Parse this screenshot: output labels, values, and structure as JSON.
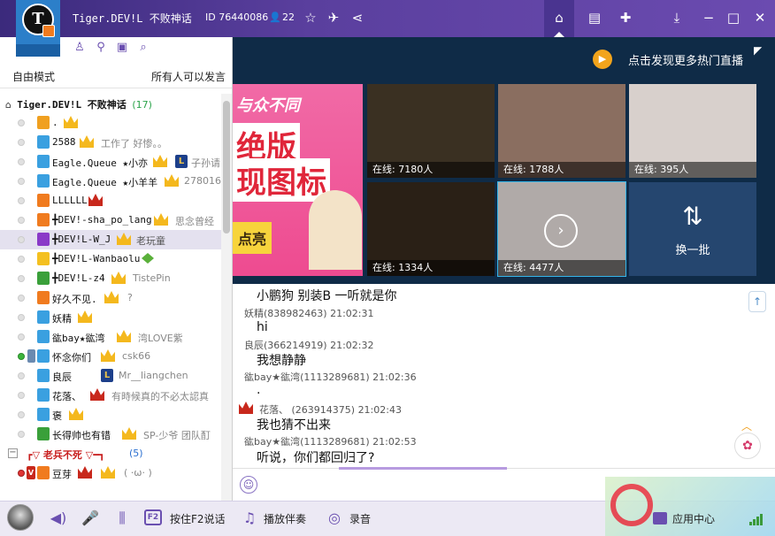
{
  "titlebar": {
    "logo_letter": "T",
    "channel_name": "Tiger.DEV!L 不败神话",
    "id_label": "ID 76440086",
    "online_count": "22"
  },
  "left": {
    "mode": "自由模式",
    "speak_rule": "所有人可以发言",
    "channel": {
      "name": "Tiger.DEV!L 不败神话",
      "count": "(17)"
    },
    "users": [
      {
        "name": ".",
        "sig": "",
        "rank_color": "#f0a020"
      },
      {
        "name": "2588",
        "sig": "工作了 好惨。。",
        "rank_color": "#3aa0e0"
      },
      {
        "name": "Eagle.Queue ★小亦",
        "sig": "子孙请",
        "rank_color": "#3aa0e0"
      },
      {
        "name": "Eagle.Queue ★小羊羊",
        "sig": "278016",
        "rank_color": "#3aa0e0"
      },
      {
        "name": "LLLLLL",
        "sig": "",
        "rank_color": "#f07b1f"
      },
      {
        "name": "╋DEV!-sha_po_lang",
        "sig": "思念曾经",
        "rank_color": "#f07b1f"
      },
      {
        "name": "╋DEV!L-W_J",
        "sig": "老玩童",
        "rank_color": "#8a3ac8"
      },
      {
        "name": "╋DEV!L-Wanbaolu",
        "sig": "",
        "rank_color": "#f4c020"
      },
      {
        "name": "╋DEV!L-z4",
        "sig": "TistePin",
        "rank_color": "#3aa03a"
      },
      {
        "name": "好久不见.",
        "sig": "?",
        "rank_color": "#f07b1f"
      },
      {
        "name": "妖精",
        "sig": "",
        "rank_color": "#3aa0e0"
      },
      {
        "name": "谹bay★谹湾",
        "sig": "湾LOVE紫",
        "rank_color": "#3aa0e0"
      },
      {
        "name": "怀念你们",
        "sig": "csk66",
        "rank_color": "#3aa0e0"
      },
      {
        "name": "良辰",
        "sig": "Mr__liangchen",
        "rank_color": "#3aa0e0"
      },
      {
        "name": "花落、",
        "sig": "有時候真的不必太認真",
        "rank_color": "#3aa0e0"
      },
      {
        "name": "褒",
        "sig": "",
        "rank_color": "#3aa0e0"
      },
      {
        "name": "长得帅也有错",
        "sig": "SP-少爷  团队酊",
        "rank_color": "#3aa03a"
      }
    ],
    "group": {
      "name": "┏▽ 老兵不死 ▽━┓",
      "count": "(5)"
    },
    "group_user": {
      "name": "豆芽",
      "sig": "( ·ω· )"
    }
  },
  "stage": {
    "discover": "点击发现更多热门直播",
    "banner": {
      "line1": "与众不同",
      "line2": "绝版",
      "line3": "现图标",
      "line4": "点亮"
    },
    "tiles": [
      {
        "caption": "在线: 7180人",
        "bg": "#3a3022"
      },
      {
        "caption": "在线: 1788人",
        "bg": "#8a6e60"
      },
      {
        "caption": "在线: 395人",
        "bg": "#d8d0cc"
      },
      {
        "caption": "在线: 1334人",
        "bg": "#2a2016"
      },
      {
        "caption": "在线: 4477人",
        "bg": "#b0aaa8"
      }
    ],
    "refresh": "换一批"
  },
  "chat": {
    "messages": [
      {
        "type": "text",
        "text": "小鹏狗 别装B 一听就是你"
      },
      {
        "type": "meta",
        "text": "妖精(838982463) 21:02:31"
      },
      {
        "type": "text",
        "text": "hi"
      },
      {
        "type": "meta",
        "text": "良辰(366214919) 21:02:32"
      },
      {
        "type": "text",
        "text": "我想静静"
      },
      {
        "type": "meta",
        "text": "谹bay★谹湾(1113289681) 21:02:36"
      },
      {
        "type": "text",
        "text": "."
      },
      {
        "type": "meta",
        "text": "花落、 (263914375) 21:02:43"
      },
      {
        "type": "text",
        "text": "我也猜不出来"
      },
      {
        "type": "meta",
        "text": "谹bay★谹湾(1113289681) 21:02:53"
      },
      {
        "type": "text",
        "text": "听说，你们都回归了?"
      }
    ]
  },
  "bottom": {
    "f2": "F2",
    "push_to_talk": "按住F2说话",
    "accompany": "播放伴奏",
    "record": "录音",
    "app_center": "应用中心"
  },
  "colors": {
    "accent": "#6a4fb0",
    "title_bg": "#5a3f9e",
    "stage_bg": "#0f2b47"
  }
}
